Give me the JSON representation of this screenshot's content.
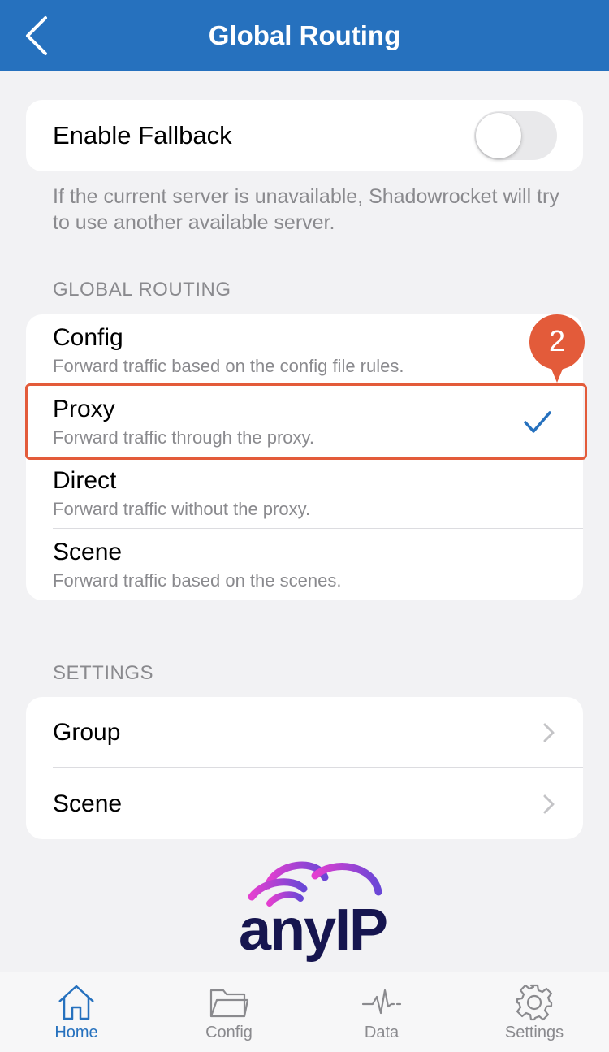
{
  "header": {
    "title": "Global Routing",
    "back_icon": "chevron-left-icon"
  },
  "fallback": {
    "label": "Enable Fallback",
    "enabled": false,
    "note": "If the current server is unavailable, Shadowrocket will try to use another available server."
  },
  "routing": {
    "header": "GLOBAL ROUTING",
    "selected": "Proxy",
    "options": [
      {
        "title": "Config",
        "subtitle": "Forward traffic based on the config file rules."
      },
      {
        "title": "Proxy",
        "subtitle": "Forward traffic through the proxy."
      },
      {
        "title": "Direct",
        "subtitle": "Forward traffic without the proxy."
      },
      {
        "title": "Scene",
        "subtitle": "Forward traffic based on the scenes."
      }
    ]
  },
  "annotation": {
    "step": "2",
    "color": "#e35b3a"
  },
  "settings": {
    "header": "SETTINGS",
    "items": [
      {
        "label": "Group"
      },
      {
        "label": "Scene"
      }
    ]
  },
  "watermark": {
    "text": "anyIP"
  },
  "tabbar": {
    "active": "Home",
    "tabs": [
      {
        "label": "Home",
        "icon": "home-icon"
      },
      {
        "label": "Config",
        "icon": "folder-icon"
      },
      {
        "label": "Data",
        "icon": "pulse-icon"
      },
      {
        "label": "Settings",
        "icon": "gear-icon"
      }
    ]
  },
  "colors": {
    "nav": "#2671be",
    "accent": "#2671be",
    "background": "#f2f2f4"
  }
}
